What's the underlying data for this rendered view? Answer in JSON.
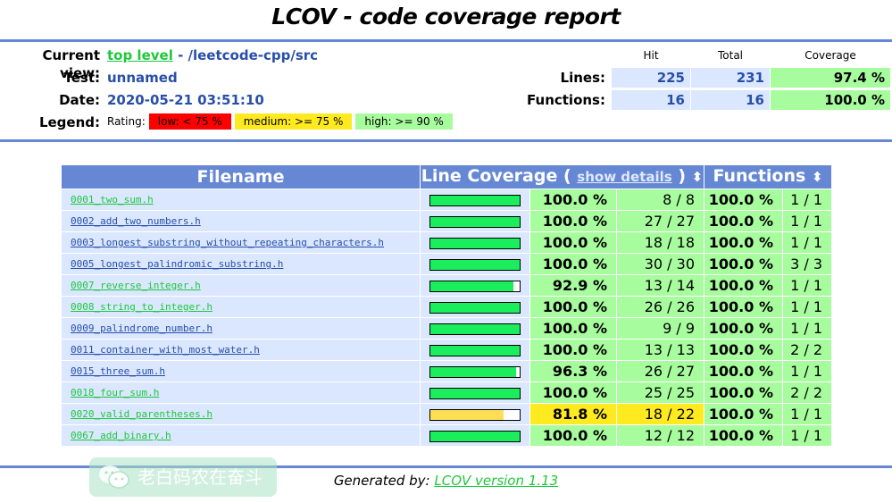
{
  "title": "LCOV - code coverage report",
  "header": {
    "current_view_label": "Current view:",
    "current_view_link": "top level",
    "current_view_path": " - /leetcode-cpp/src",
    "test_label": "Test:",
    "test_value": "unnamed",
    "date_label": "Date:",
    "date_value": "2020-05-21 03:51:10",
    "legend_label": "Legend:",
    "legend_rating": "Rating:",
    "legend": [
      {
        "label": "low: < 75 %",
        "color": "#ff0000"
      },
      {
        "label": "medium: >= 75 %",
        "color": "#ffea20"
      },
      {
        "label": "high: >= 90 %",
        "color": "#a7fc9d"
      }
    ]
  },
  "summary": {
    "col_hit": "Hit",
    "col_total": "Total",
    "col_coverage": "Coverage",
    "lines_label": "Lines:",
    "lines_hit": "225",
    "lines_total": "231",
    "lines_coverage": "97.4 %",
    "functions_label": "Functions:",
    "functions_hit": "16",
    "functions_total": "16",
    "functions_coverage": "100.0 %"
  },
  "table": {
    "col_filename": "Filename",
    "col_line_coverage": "Line Coverage (",
    "show_details": "show details",
    "col_line_coverage_end": ")",
    "col_functions": "Functions",
    "sort_icon": "⬍",
    "rows": [
      {
        "name": "0001_two_sum.h",
        "visited": true,
        "line_pct": "100.0 %",
        "line_frac": 1.0,
        "line_cnt": "8 / 8",
        "rating": "hi",
        "fn_pct": "100.0 %",
        "fn_cnt": "1 / 1"
      },
      {
        "name": "0002_add_two_numbers.h",
        "visited": false,
        "line_pct": "100.0 %",
        "line_frac": 1.0,
        "line_cnt": "27 / 27",
        "rating": "hi",
        "fn_pct": "100.0 %",
        "fn_cnt": "1 / 1"
      },
      {
        "name": "0003_longest_substring_without_repeating_characters.h",
        "visited": false,
        "line_pct": "100.0 %",
        "line_frac": 1.0,
        "line_cnt": "18 / 18",
        "rating": "hi",
        "fn_pct": "100.0 %",
        "fn_cnt": "1 / 1"
      },
      {
        "name": "0005_longest_palindromic_substring.h",
        "visited": false,
        "line_pct": "100.0 %",
        "line_frac": 1.0,
        "line_cnt": "30 / 30",
        "rating": "hi",
        "fn_pct": "100.0 %",
        "fn_cnt": "3 / 3"
      },
      {
        "name": "0007_reverse_integer.h",
        "visited": true,
        "line_pct": "92.9 %",
        "line_frac": 0.929,
        "line_cnt": "13 / 14",
        "rating": "hi",
        "fn_pct": "100.0 %",
        "fn_cnt": "1 / 1"
      },
      {
        "name": "0008_string_to_integer.h",
        "visited": true,
        "line_pct": "100.0 %",
        "line_frac": 1.0,
        "line_cnt": "26 / 26",
        "rating": "hi",
        "fn_pct": "100.0 %",
        "fn_cnt": "1 / 1"
      },
      {
        "name": "0009_palindrome_number.h",
        "visited": false,
        "line_pct": "100.0 %",
        "line_frac": 1.0,
        "line_cnt": "9 / 9",
        "rating": "hi",
        "fn_pct": "100.0 %",
        "fn_cnt": "1 / 1"
      },
      {
        "name": "0011_container_with_most_water.h",
        "visited": false,
        "line_pct": "100.0 %",
        "line_frac": 1.0,
        "line_cnt": "13 / 13",
        "rating": "hi",
        "fn_pct": "100.0 %",
        "fn_cnt": "2 / 2"
      },
      {
        "name": "0015_three_sum.h",
        "visited": false,
        "line_pct": "96.3 %",
        "line_frac": 0.963,
        "line_cnt": "26 / 27",
        "rating": "hi",
        "fn_pct": "100.0 %",
        "fn_cnt": "1 / 1"
      },
      {
        "name": "0018_four_sum.h",
        "visited": true,
        "line_pct": "100.0 %",
        "line_frac": 1.0,
        "line_cnt": "25 / 25",
        "rating": "hi",
        "fn_pct": "100.0 %",
        "fn_cnt": "2 / 2"
      },
      {
        "name": "0020_valid_parentheses.h",
        "visited": true,
        "line_pct": "81.8 %",
        "line_frac": 0.818,
        "line_cnt": "18 / 22",
        "rating": "med",
        "fn_pct": "100.0 %",
        "fn_cnt": "1 / 1"
      },
      {
        "name": "0067_add_binary.h",
        "visited": true,
        "line_pct": "100.0 %",
        "line_frac": 1.0,
        "line_cnt": "12 / 12",
        "rating": "hi",
        "fn_pct": "100.0 %",
        "fn_cnt": "1 / 1"
      }
    ]
  },
  "colors": {
    "link_visited": "#1ec83c",
    "link_unvisited": "#284fa8",
    "bar_hi": "#1aee5c",
    "bar_med": "#ffdd55",
    "bar_lo": "#ff0000"
  },
  "footer": {
    "generated_by": "Generated by: ",
    "tool_link": "LCOV version 1.13"
  },
  "watermark": {
    "text": "老白码农在奋斗"
  }
}
